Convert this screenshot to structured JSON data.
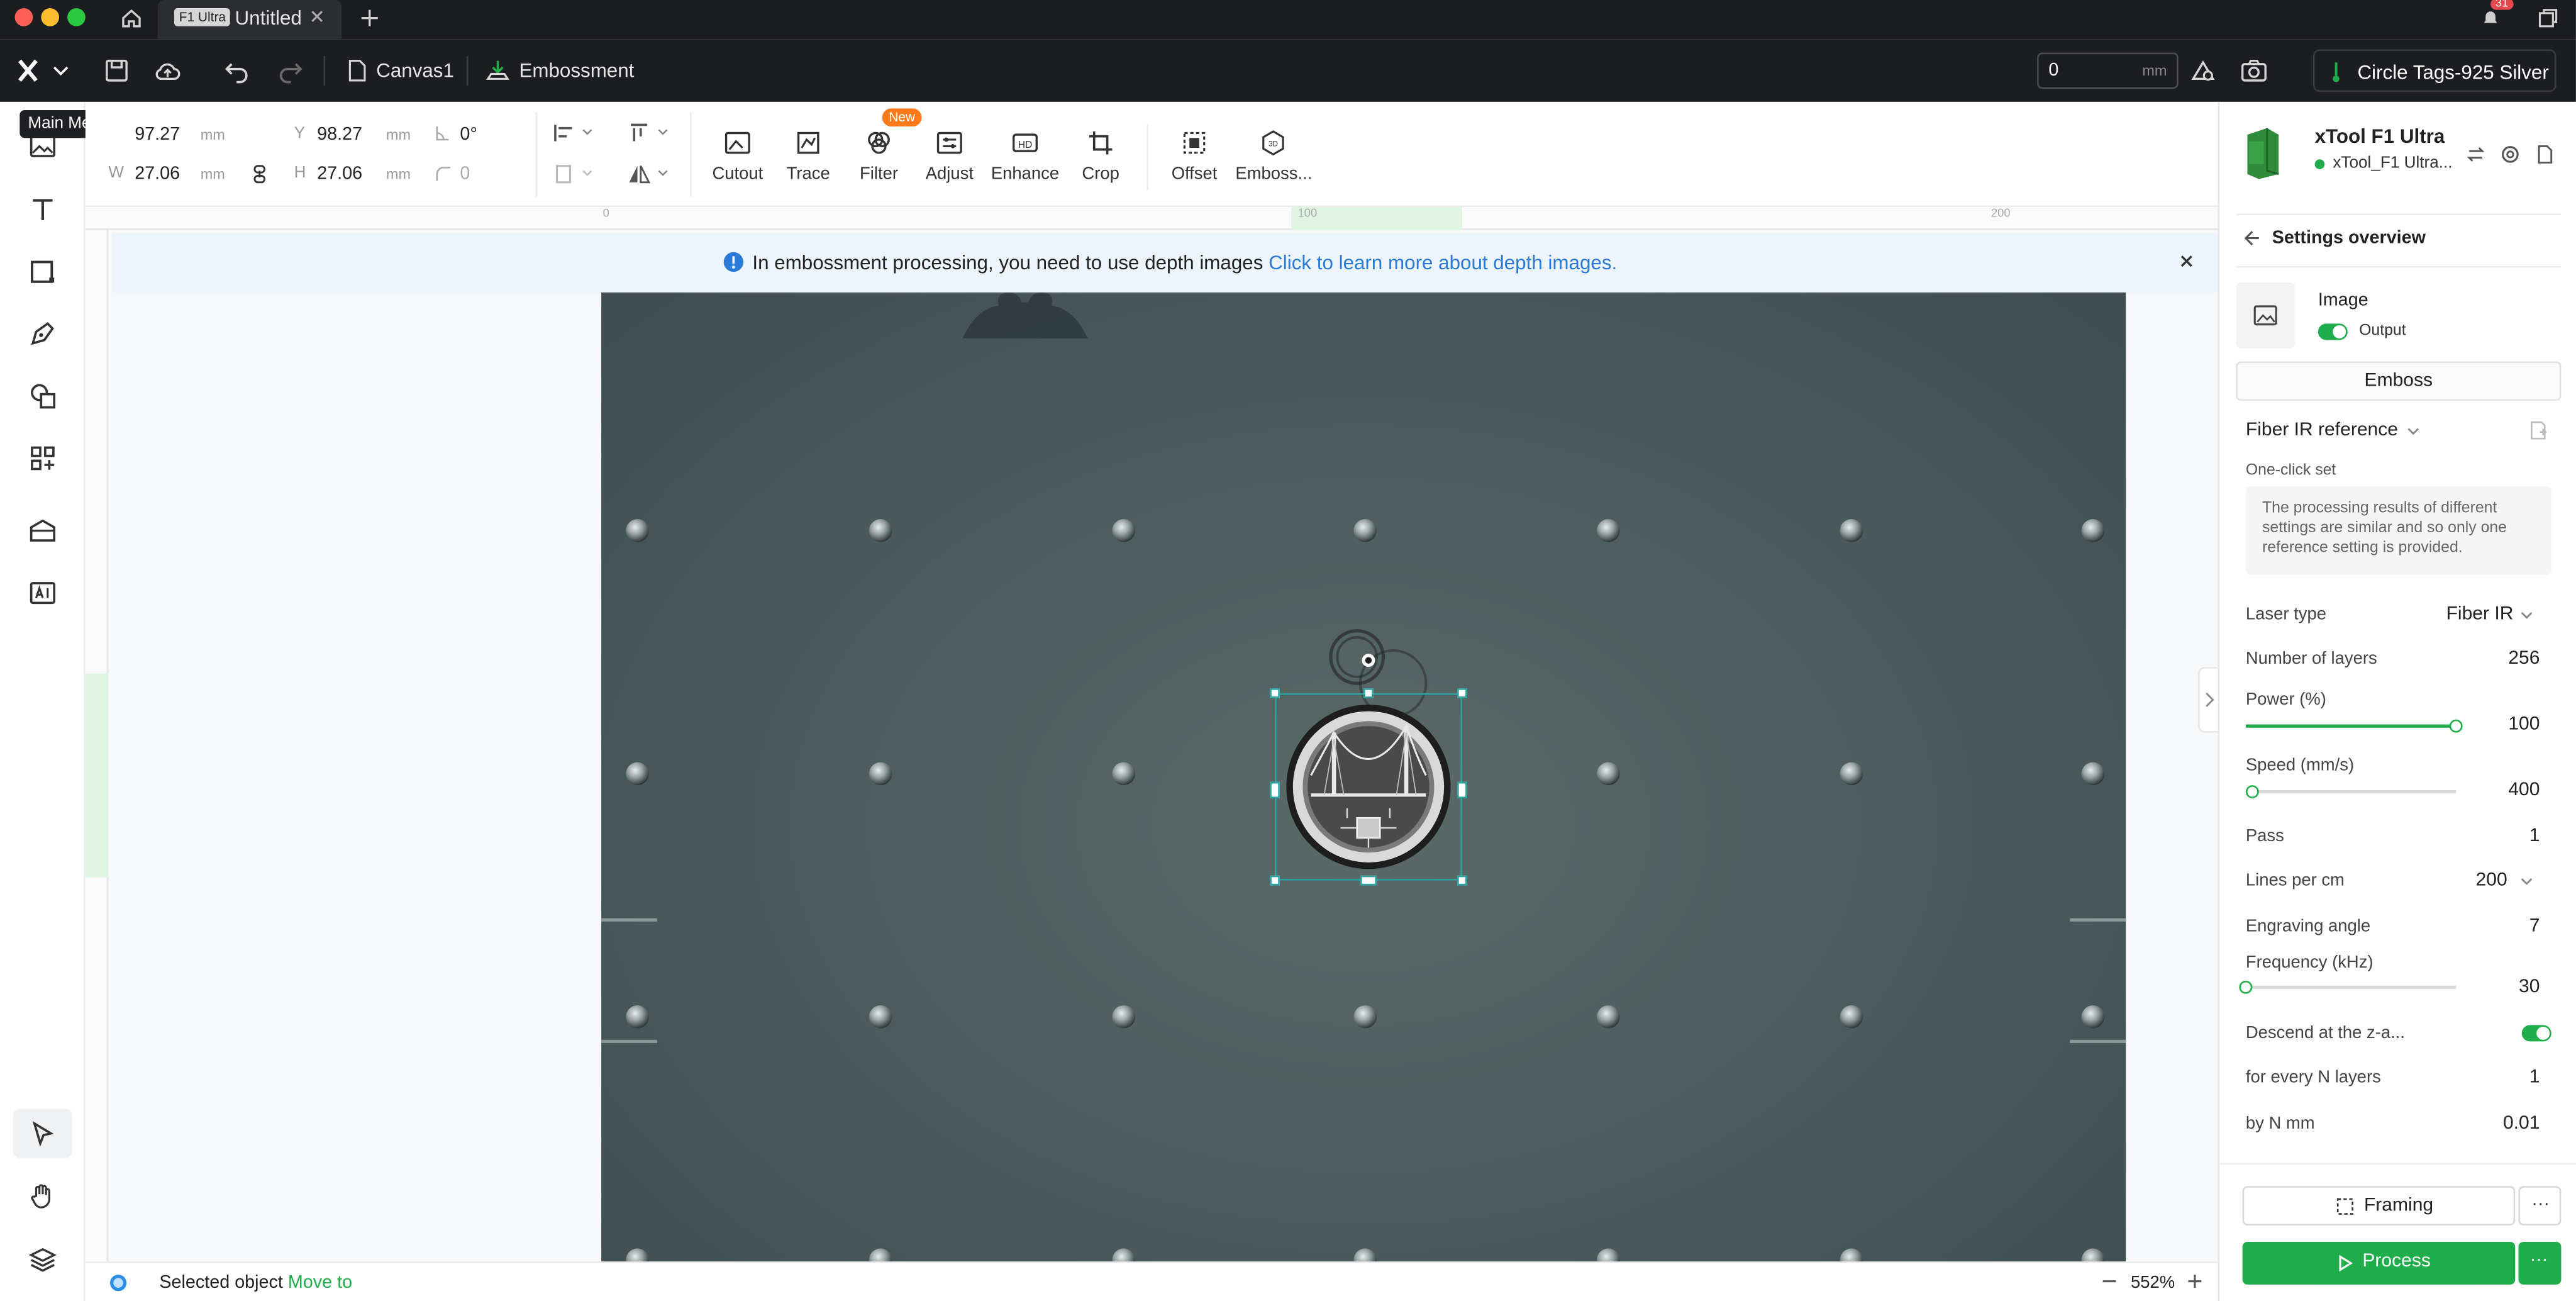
{
  "titlebar": {
    "tab_badge": "F1 Ultra",
    "tab_title": "Untitled",
    "notification_count": "31"
  },
  "toolbar": {
    "canvas_name": "Canvas1",
    "mode_name": "Embossment",
    "height_value": "0",
    "height_unit": "mm",
    "material": "Circle Tags-925 Silver",
    "tooltip": "Main Menu"
  },
  "properties": {
    "x_value": "97.27",
    "y_label": "Y",
    "y_value": "98.27",
    "w_label": "W",
    "w_value": "27.06",
    "h_label": "H",
    "h_value": "27.06",
    "unit": "mm",
    "rotation": "0°",
    "corner": "0"
  },
  "tools": [
    {
      "label": "Cutout"
    },
    {
      "label": "Trace"
    },
    {
      "label": "Filter"
    },
    {
      "label": "Adjust"
    },
    {
      "label": "Enhance"
    },
    {
      "label": "Crop"
    },
    {
      "label": "Offset"
    },
    {
      "label": "Emboss..."
    }
  ],
  "new_badge": "New",
  "ruler": {
    "t0": "0",
    "t100": "100",
    "t200": "200"
  },
  "banner": {
    "text": "In embossment processing, you need to use depth images",
    "link": "Click to learn more about depth images."
  },
  "device": {
    "name": "xTool F1 Ultra",
    "connection": "xTool_F1 Ultra..."
  },
  "settings": {
    "header": "Settings overview",
    "image_label": "Image",
    "output_label": "Output",
    "mode_button": "Emboss",
    "reference": "Fiber IR reference",
    "one_click": "One-click set",
    "note": "The processing results of different settings are similar and so only one reference setting is provided.",
    "laser_type_label": "Laser type",
    "laser_type_value": "Fiber IR",
    "layers_label": "Number of layers",
    "layers_value": "256",
    "power_label": "Power (%)",
    "power_value": "100",
    "power_fraction": 1.0,
    "speed_label": "Speed (mm/s)",
    "speed_value": "400",
    "speed_fraction": 0.03,
    "pass_label": "Pass",
    "pass_value": "1",
    "lines_label": "Lines per cm",
    "lines_value": "200",
    "angle_label": "Engraving angle",
    "angle_value": "7",
    "freq_label": "Frequency (kHz)",
    "freq_value": "30",
    "freq_fraction": 0.0,
    "descend_label": "Descend at the z-a...",
    "every_label": "for every N layers",
    "every_value": "1",
    "byn_label": "by N mm",
    "byn_value": "0.01",
    "framing_label": "Framing",
    "process_label": "Process"
  },
  "status": {
    "selected": "Selected object",
    "move_to": "Move to",
    "zoom": "552%"
  },
  "colors": {
    "accent_green": "#1fae4b",
    "link_blue": "#2a7ad8",
    "dark_bar": "#1c1d20"
  }
}
